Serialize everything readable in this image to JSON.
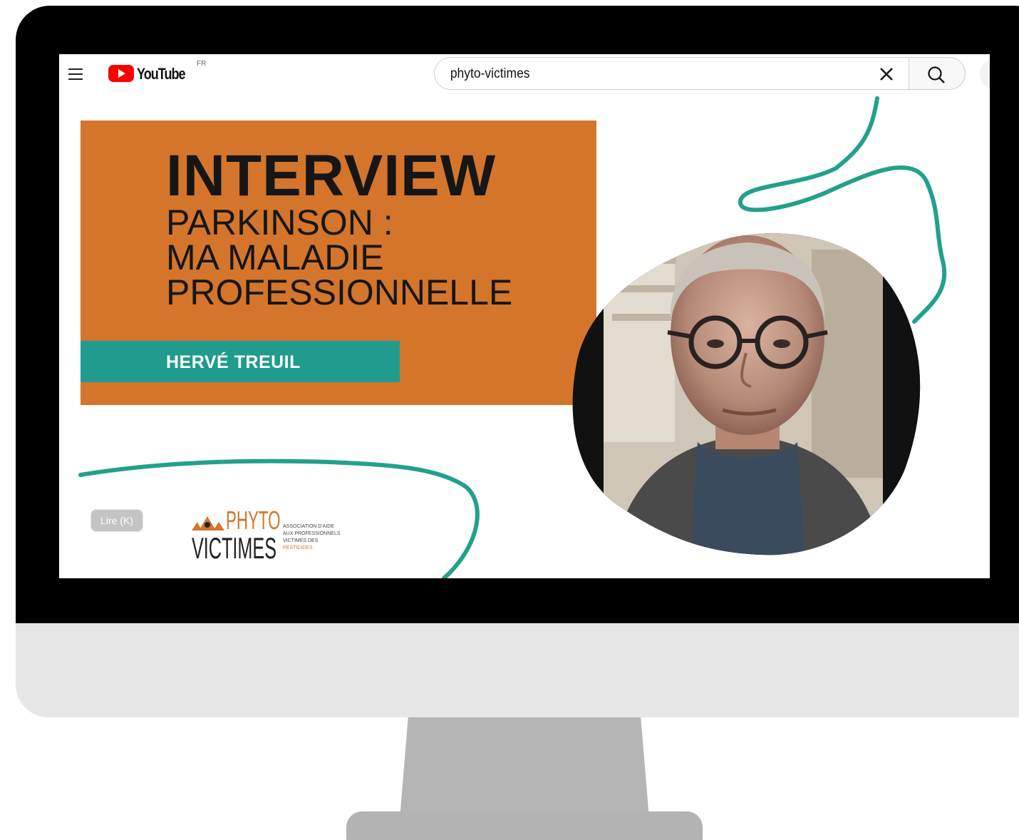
{
  "header": {
    "brand": "YouTube",
    "country": "FR",
    "search": {
      "query": "phyto-victimes"
    }
  },
  "thumbnail": {
    "title": "INTERVIEW",
    "subtitle_lines": [
      "PARKINSON :",
      "MA MALADIE",
      "PROFESSIONNELLE"
    ],
    "name": "HERVÉ TREUIL",
    "play_button": "Lire (K)",
    "logo": {
      "word1": "PHYTO",
      "word2": "VICTIMES",
      "tagline_lines": [
        "Association d'aide",
        "aux professionnels",
        "victimes des",
        "pesticides"
      ]
    }
  },
  "colors": {
    "orange": "#d4752b",
    "teal": "#1f9c8e",
    "youtube_red": "#ff0000"
  },
  "icons": [
    "menu-icon",
    "youtube-logo-icon",
    "clear-icon",
    "search-icon",
    "microphone-icon",
    "pesticide-logo-icon"
  ]
}
